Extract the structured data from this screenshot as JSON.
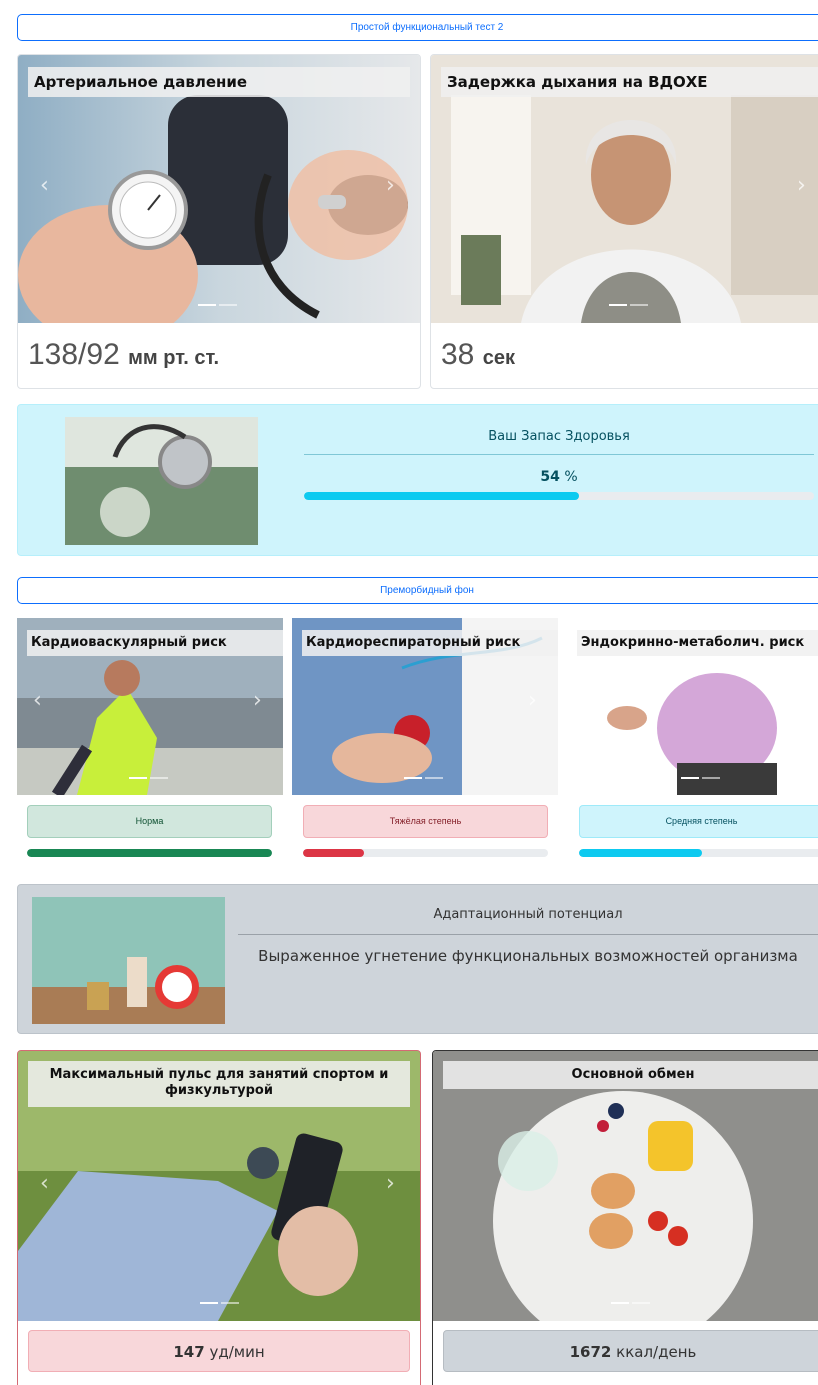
{
  "sections": {
    "functional_test": "Простой функциональный тест 2",
    "premorbid": "Преморбидный фон"
  },
  "cards": {
    "blood_pressure": {
      "title": "Артериальное давление",
      "value": "138/92",
      "unit": "мм рт. ст."
    },
    "breath_hold": {
      "title": "Задержка дыхания на ВДОХЕ",
      "value": "38",
      "unit": "сек"
    }
  },
  "health_reserve": {
    "title": "Ваш Запас Здоровья",
    "value": "54",
    "unit": "%",
    "progress": 54,
    "color": "#0dcaf0",
    "bg": "#cff4fc"
  },
  "risks": [
    {
      "title": "Кардиоваскулярный риск",
      "status": "Норма",
      "progress": 100,
      "color": "#198754",
      "label_bg": "#d1e7dd",
      "label_border": "#a3cfbb",
      "label_color": "#0f5132"
    },
    {
      "title": "Кардиореспираторный риск",
      "status": "Тяжёлая степень",
      "progress": 25,
      "color": "#dc3545",
      "label_bg": "#f8d7da",
      "label_border": "#f1aeb5",
      "label_color": "#842029"
    },
    {
      "title": "Эндокринно-метаболич. риск",
      "status": "Средняя степень",
      "progress": 50,
      "color": "#0dcaf0",
      "label_bg": "#cff4fc",
      "label_border": "#9eeaf9",
      "label_color": "#055160"
    }
  ],
  "adaptation": {
    "title": "Адаптационный потенциал",
    "text": "Выраженное угнетение функциональных возможностей организма",
    "bg": "#ced4da"
  },
  "max_pulse": {
    "title": "Максимальный пульс для занятий спортом и физкультурой",
    "value": "147",
    "unit": "уд/мин",
    "bg": "#f8d7da"
  },
  "metabolism": {
    "title": "Основной обмен",
    "value": "1672",
    "unit": "ккал/день",
    "bg": "#ced4da"
  },
  "icons": {
    "prev": "‹",
    "next": "›"
  }
}
